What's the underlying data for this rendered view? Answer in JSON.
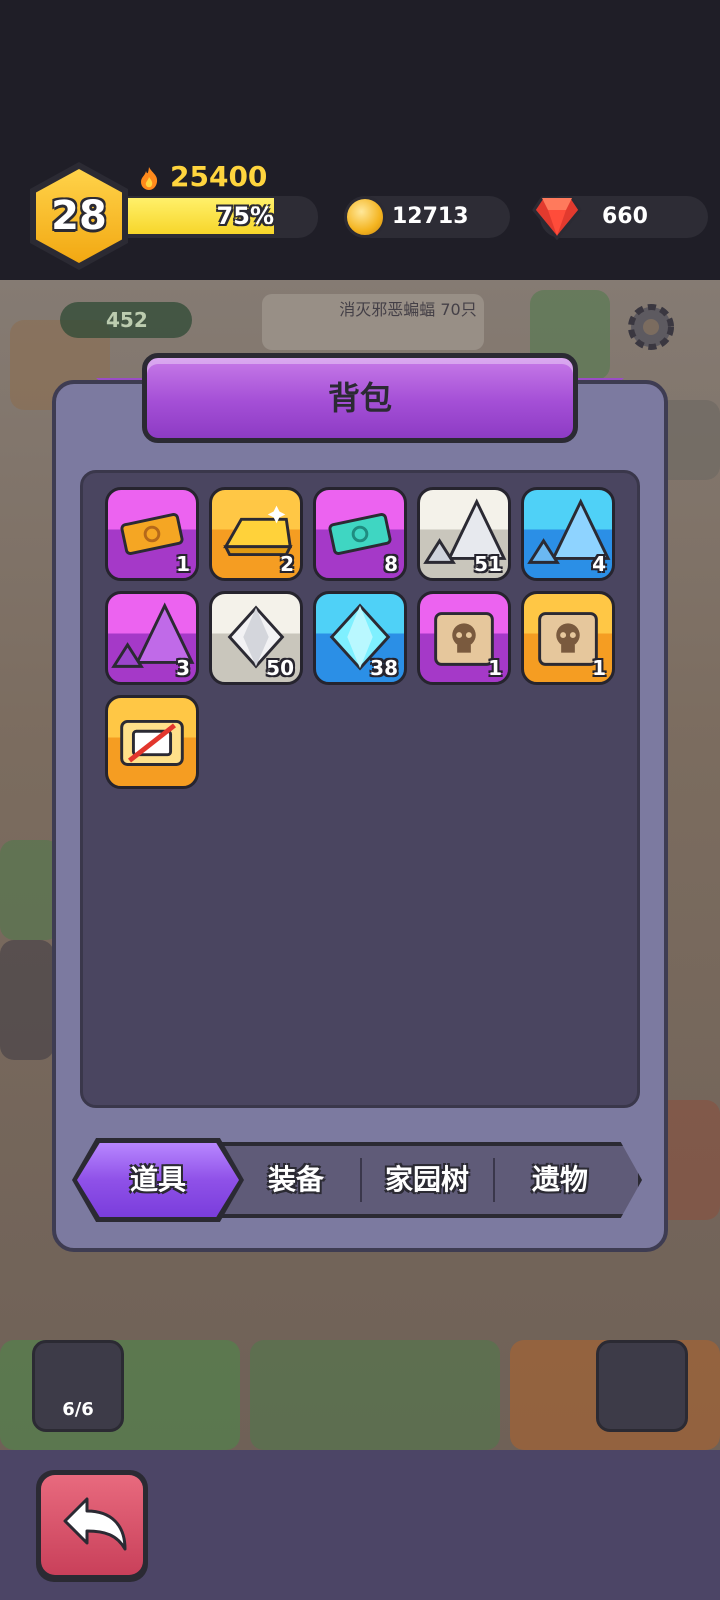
{
  "player": {
    "level": "28",
    "power": "25400",
    "xp_percent_label": "75%",
    "xp_fraction": 0.75
  },
  "resources": {
    "coins": "12713",
    "gems": "660"
  },
  "background_hud": {
    "meat": "452",
    "quest_text": "消灭邪恶蝙蝠 70只",
    "pet_count": "6/6"
  },
  "panel": {
    "title": "背包"
  },
  "inventory": [
    {
      "icon": "purple-ticket-icon",
      "count": "1",
      "rarity": "purple"
    },
    {
      "icon": "gold-bar-icon",
      "count": "2",
      "rarity": "gold"
    },
    {
      "icon": "teal-ticket-icon",
      "count": "8",
      "rarity": "purple"
    },
    {
      "icon": "white-stone-pile-icon",
      "count": "51",
      "rarity": "grey"
    },
    {
      "icon": "blue-stone-pile-icon",
      "count": "4",
      "rarity": "blue"
    },
    {
      "icon": "purple-stone-pile-icon",
      "count": "3",
      "rarity": "purple"
    },
    {
      "icon": "white-diamond-icon",
      "count": "50",
      "rarity": "grey"
    },
    {
      "icon": "blue-diamond-icon",
      "count": "38",
      "rarity": "blue"
    },
    {
      "icon": "skull-scroll-icon",
      "count": "1",
      "rarity": "purple"
    },
    {
      "icon": "skull-scroll-icon",
      "count": "1",
      "rarity": "gold"
    },
    {
      "icon": "no-ads-card-icon",
      "count": "",
      "rarity": "gold"
    }
  ],
  "tabs": [
    {
      "label": "道具",
      "active": true
    },
    {
      "label": "装备",
      "active": false
    },
    {
      "label": "家园树",
      "active": false
    },
    {
      "label": "遗物",
      "active": false
    }
  ],
  "colors": {
    "accent_purple": "#a44fd6",
    "xp_yellow": "#f7d62a",
    "back_button": "#c9405a"
  }
}
